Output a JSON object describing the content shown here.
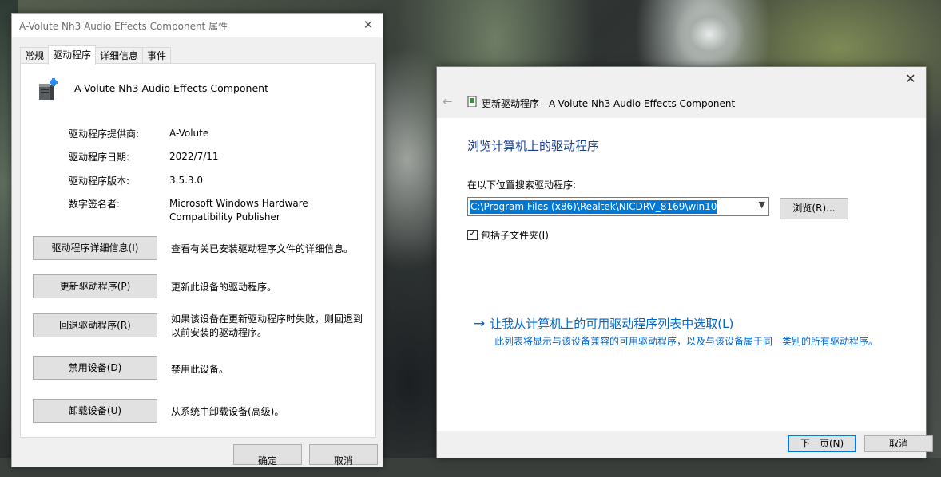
{
  "properties_dialog": {
    "title": "A-Volute Nh3 Audio Effects Component 属性",
    "tabs": [
      {
        "label": "常规"
      },
      {
        "label": "驱动程序"
      },
      {
        "label": "详细信息"
      },
      {
        "label": "事件"
      }
    ],
    "device_name": "A-Volute Nh3 Audio Effects Component",
    "info": {
      "provider_label": "驱动程序提供商:",
      "provider_value": "A-Volute",
      "date_label": "驱动程序日期:",
      "date_value": "2022/7/11",
      "version_label": "驱动程序版本:",
      "version_value": "3.5.3.0",
      "signer_label": "数字签名者:",
      "signer_value": "Microsoft Windows Hardware Compatibility Publisher"
    },
    "actions": [
      {
        "label": "驱动程序详细信息(I)",
        "desc": "查看有关已安装驱动程序文件的详细信息。"
      },
      {
        "label": "更新驱动程序(P)",
        "desc": "更新此设备的驱动程序。"
      },
      {
        "label": "回退驱动程序(R)",
        "desc": "如果该设备在更新驱动程序时失败，则回退到以前安装的驱动程序。"
      },
      {
        "label": "禁用设备(D)",
        "desc": "禁用此设备。"
      },
      {
        "label": "卸载设备(U)",
        "desc": "从系统中卸载设备(高级)。"
      }
    ],
    "ok_label": "确定",
    "cancel_label": "取消"
  },
  "wizard": {
    "title": "更新驱动程序 - A-Volute Nh3 Audio Effects Component",
    "heading": "浏览计算机上的驱动程序",
    "search_label": "在以下位置搜索驱动程序:",
    "path_value": "C:\\Program Files (x86)\\Realtek\\NICDRV_8169\\win10",
    "browse_label": "浏览(R)...",
    "include_subfolders_label": "包括子文件夹(I)",
    "include_subfolders_checked": true,
    "pick_link": "让我从计算机上的可用驱动程序列表中选取(L)",
    "pick_desc": "此列表将显示与该设备兼容的可用驱动程序，以及与该设备属于同一类别的所有驱动程序。",
    "next_label": "下一页(N)",
    "cancel_label": "取消"
  },
  "colors": {
    "accent": "#0078d7",
    "heading_blue": "#1a3e8c",
    "link_blue": "#0066cc"
  }
}
